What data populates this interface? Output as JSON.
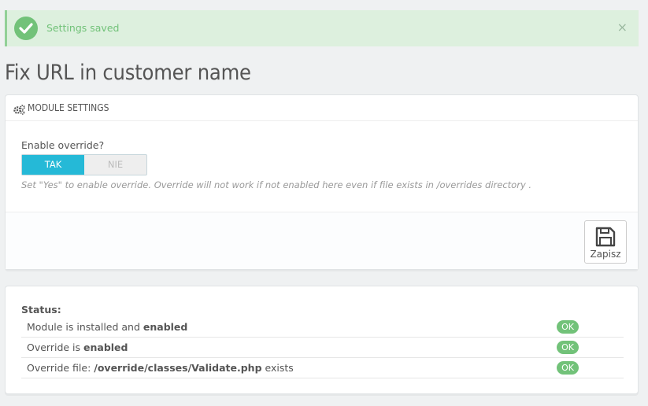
{
  "alert": {
    "message": "Settings saved",
    "close": "×"
  },
  "page_title": "Fix URL in customer name",
  "module_settings": {
    "heading": "MODULE SETTINGS",
    "enable_label": "Enable override?",
    "switch_on": "TAK",
    "switch_off": "NIE",
    "switch_selected": "TAK",
    "help": "Set \"Yes\" to enable override. Override will not work if not enabled here even if file exists in /overrides directory .",
    "save_label": "Zapisz"
  },
  "status": {
    "title": "Status:",
    "rows": [
      {
        "prefix": "Module is installed and ",
        "bold": "enabled",
        "suffix": "",
        "badge": "OK"
      },
      {
        "prefix": "Override is ",
        "bold": "enabled",
        "suffix": "",
        "badge": "OK"
      },
      {
        "prefix": "Override file: ",
        "bold": "/override/classes/Validate.php",
        "suffix": " exists",
        "badge": "OK"
      }
    ]
  },
  "colors": {
    "accent": "#25b9d7",
    "success": "#72c279",
    "alert_bg": "#ddf0de"
  }
}
